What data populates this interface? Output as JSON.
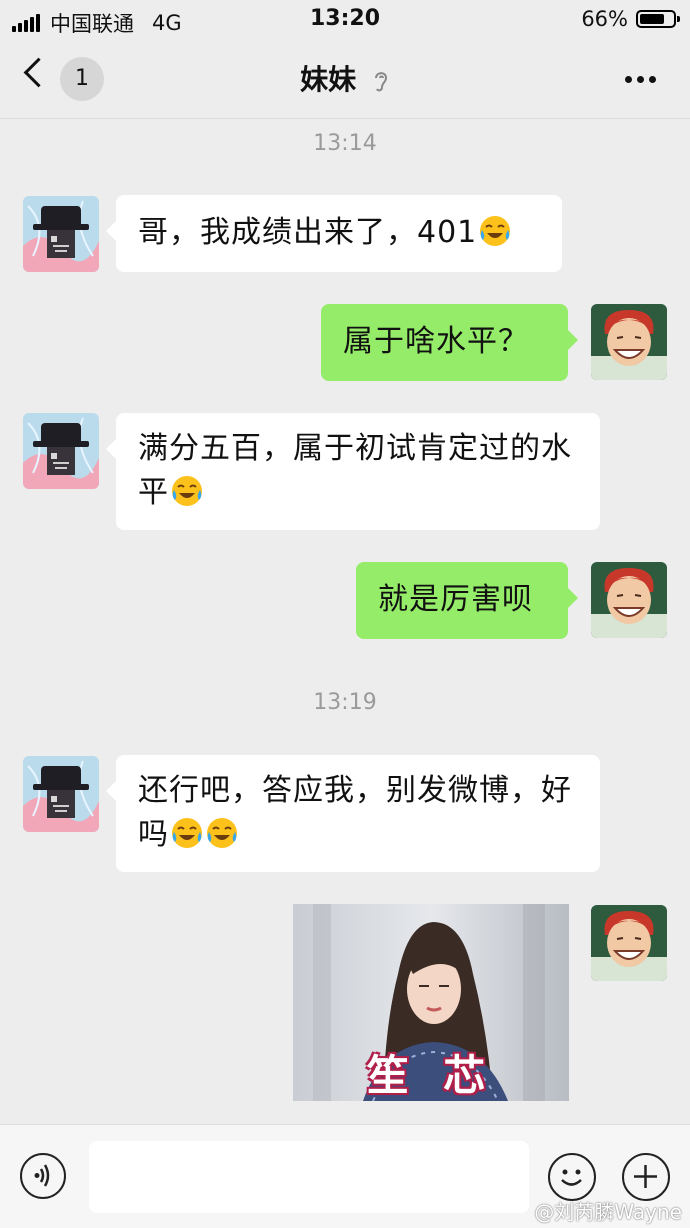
{
  "status_bar": {
    "carrier": "中国联通",
    "network": "4G",
    "time": "13:20",
    "battery": "66%"
  },
  "nav": {
    "unread_count": "1",
    "title": "妹妹"
  },
  "chat": {
    "timestamps": [
      "13:14",
      "13:19"
    ],
    "messages": [
      {
        "side": "in",
        "text": "哥，我成绩出来了，401"
      },
      {
        "side": "out",
        "text": "属于啥水平？"
      },
      {
        "side": "in",
        "text": "满分五百，属于初试肯定过的水平"
      },
      {
        "side": "out",
        "text": "就是厉害呗"
      },
      {
        "side": "in",
        "text": "还行吧，答应我，别发微博，好吗"
      },
      {
        "side": "out",
        "type": "sticker",
        "caption": "笙 芯"
      }
    ]
  },
  "watermark": "@刘芮膦Wayne",
  "colors": {
    "background": "#ededed",
    "outgoing_bubble": "#95ec69",
    "incoming_bubble": "#ffffff"
  },
  "icons": [
    "back-chevron-icon",
    "ear-icon",
    "more-icon",
    "voice-icon",
    "emoji-icon",
    "plus-icon",
    "cry-laugh-emoji"
  ]
}
